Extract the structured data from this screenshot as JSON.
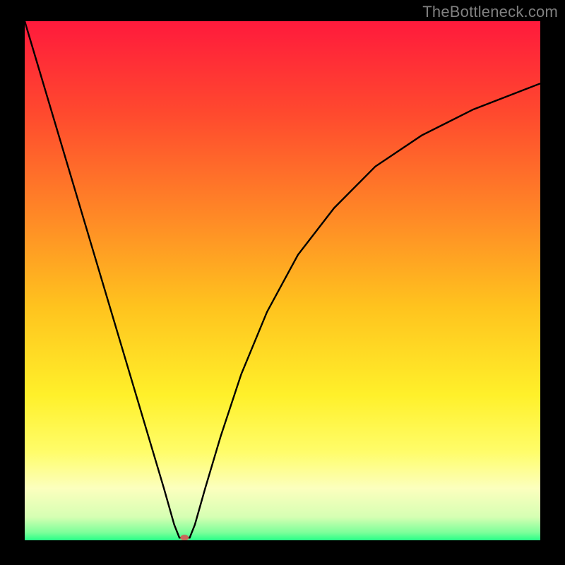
{
  "watermark": "TheBottleneck.com",
  "chart_data": {
    "type": "line",
    "title": "",
    "xlabel": "",
    "ylabel": "",
    "xlim": [
      0,
      100
    ],
    "ylim": [
      0,
      100
    ],
    "background_gradient": {
      "stops": [
        {
          "offset": 0.0,
          "color": "#ff1a3c"
        },
        {
          "offset": 0.18,
          "color": "#ff4a2e"
        },
        {
          "offset": 0.38,
          "color": "#ff8a26"
        },
        {
          "offset": 0.55,
          "color": "#ffc31e"
        },
        {
          "offset": 0.72,
          "color": "#fff02a"
        },
        {
          "offset": 0.83,
          "color": "#fffd6a"
        },
        {
          "offset": 0.9,
          "color": "#fcffbe"
        },
        {
          "offset": 0.955,
          "color": "#d6ffb3"
        },
        {
          "offset": 0.985,
          "color": "#7dff9a"
        },
        {
          "offset": 1.0,
          "color": "#28ff87"
        }
      ]
    },
    "series": [
      {
        "name": "bottleneck-curve",
        "color": "#000000",
        "x": [
          0,
          3,
          6,
          9,
          12,
          15,
          18,
          21,
          24,
          27,
          29,
          30,
          31,
          32,
          33,
          35,
          38,
          42,
          47,
          53,
          60,
          68,
          77,
          87,
          100
        ],
        "values": [
          100,
          90,
          80,
          70,
          60,
          50,
          40,
          30,
          20,
          10,
          3,
          0.5,
          0.5,
          0.5,
          3,
          10,
          20,
          32,
          44,
          55,
          64,
          72,
          78,
          83,
          88
        ]
      }
    ],
    "marker": {
      "x": 31,
      "y": 0.5,
      "color": "#c96a5a",
      "rx": 6,
      "ry": 4.2
    }
  }
}
